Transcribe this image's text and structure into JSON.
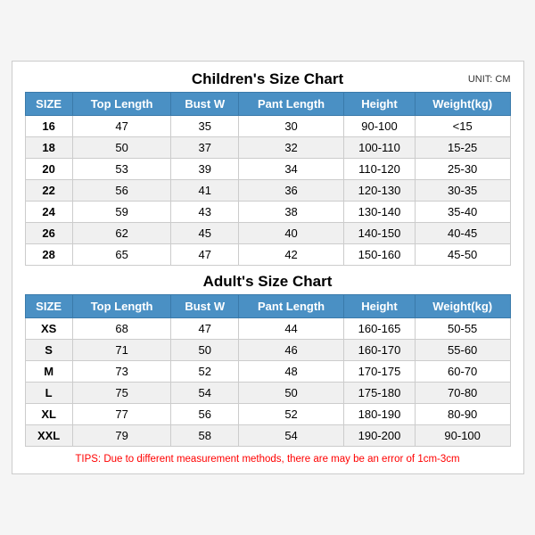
{
  "children_chart": {
    "title": "Children's Size Chart",
    "unit": "UNIT: CM",
    "headers": [
      "SIZE",
      "Top Length",
      "Bust W",
      "Pant Length",
      "Height",
      "Weight(kg)"
    ],
    "rows": [
      [
        "16",
        "47",
        "35",
        "30",
        "90-100",
        "<15"
      ],
      [
        "18",
        "50",
        "37",
        "32",
        "100-110",
        "15-25"
      ],
      [
        "20",
        "53",
        "39",
        "34",
        "110-120",
        "25-30"
      ],
      [
        "22",
        "56",
        "41",
        "36",
        "120-130",
        "30-35"
      ],
      [
        "24",
        "59",
        "43",
        "38",
        "130-140",
        "35-40"
      ],
      [
        "26",
        "62",
        "45",
        "40",
        "140-150",
        "40-45"
      ],
      [
        "28",
        "65",
        "47",
        "42",
        "150-160",
        "45-50"
      ]
    ]
  },
  "adult_chart": {
    "title": "Adult's Size Chart",
    "headers": [
      "SIZE",
      "Top Length",
      "Bust W",
      "Pant Length",
      "Height",
      "Weight(kg)"
    ],
    "rows": [
      [
        "XS",
        "68",
        "47",
        "44",
        "160-165",
        "50-55"
      ],
      [
        "S",
        "71",
        "50",
        "46",
        "160-170",
        "55-60"
      ],
      [
        "M",
        "73",
        "52",
        "48",
        "170-175",
        "60-70"
      ],
      [
        "L",
        "75",
        "54",
        "50",
        "175-180",
        "70-80"
      ],
      [
        "XL",
        "77",
        "56",
        "52",
        "180-190",
        "80-90"
      ],
      [
        "XXL",
        "79",
        "58",
        "54",
        "190-200",
        "90-100"
      ]
    ]
  },
  "tips": "TIPS: Due to different measurement methods, there are may be an error of 1cm-3cm"
}
